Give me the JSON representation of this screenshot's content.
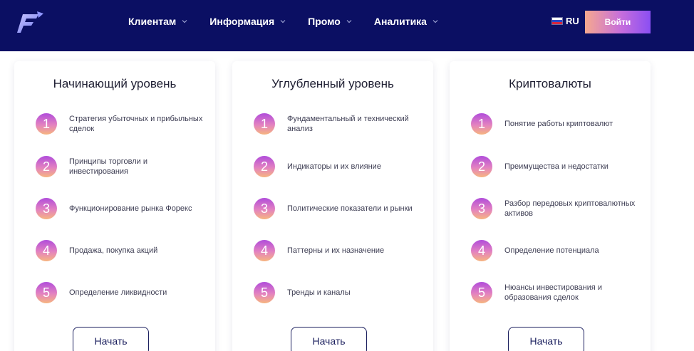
{
  "header": {
    "nav": [
      {
        "label": "Клиентам"
      },
      {
        "label": "Информация"
      },
      {
        "label": "Промо"
      },
      {
        "label": "Аналитика"
      }
    ],
    "lang": "RU",
    "login_label": "Войти"
  },
  "cards": [
    {
      "title": "Начинающий уровень",
      "items": [
        {
          "num": "1",
          "text": "Стратегия убыточных и прибыльных сделок"
        },
        {
          "num": "2",
          "text": "Принципы торговли и инвестирования"
        },
        {
          "num": "3",
          "text": "Функционирование рынка Форекс"
        },
        {
          "num": "4",
          "text": "Продажа, покупка акций"
        },
        {
          "num": "5",
          "text": "Определение ликвидности"
        }
      ],
      "button": "Начать"
    },
    {
      "title": "Углубленный уровень",
      "items": [
        {
          "num": "1",
          "text": "Фундаментальный и технический анализ"
        },
        {
          "num": "2",
          "text": "Индикаторы и их влияние"
        },
        {
          "num": "3",
          "text": "Политические показатели и рынки"
        },
        {
          "num": "4",
          "text": "Паттерны и их назначение"
        },
        {
          "num": "5",
          "text": "Тренды и каналы"
        }
      ],
      "button": "Начать"
    },
    {
      "title": "Криптовалюты",
      "items": [
        {
          "num": "1",
          "text": "Понятие работы криптовалют"
        },
        {
          "num": "2",
          "text": "Преимущества и недостатки"
        },
        {
          "num": "3",
          "text": "Разбор передовых криптовалютных активов"
        },
        {
          "num": "4",
          "text": "Определение потенциала"
        },
        {
          "num": "5",
          "text": "Нюансы инвестирования и образования сделок"
        }
      ],
      "button": "Начать"
    }
  ],
  "colors": {
    "header_bg": "#0b0f63",
    "accent_gradient": [
      "#f6a88f",
      "#c66edc",
      "#8b4ff3"
    ],
    "button_border": "#1b1f5e"
  },
  "icons": {
    "logo": "brand-logo-f",
    "nav_chevron": "chevron-down-icon",
    "lang_flag": "russia-flag-icon"
  }
}
